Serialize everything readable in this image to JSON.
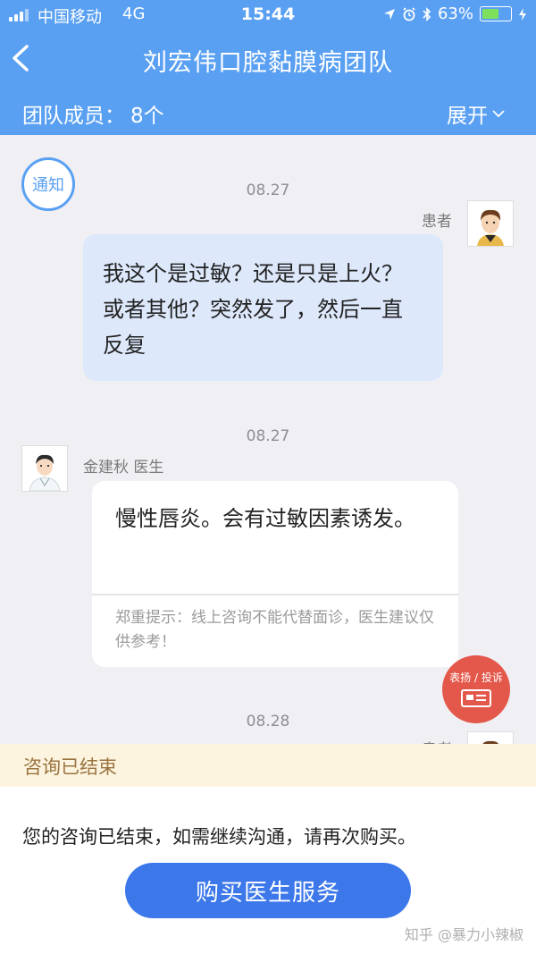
{
  "status_bar": {
    "carrier": "中国移动",
    "network": "4G",
    "time": "15:44",
    "battery": "63%",
    "battery_level": 0.63
  },
  "header": {
    "title": "刘宏伟口腔黏膜病团队",
    "team_label": "团队成员：",
    "team_count": "8个",
    "expand_label": "展开"
  },
  "notice_badge": "通知",
  "messages": [
    {
      "date": "08.27",
      "sender": "患者",
      "text": "我这个是过敏？还是只是上火？或者其他？突然发了，然后一直反复"
    },
    {
      "date": "08.27",
      "sender": "金建秋 医生",
      "text": "慢性唇炎。会有过敏因素诱发。",
      "tip": "郑重提示：线上咨询不能代替面诊，医生建议仅供参考！"
    },
    {
      "date": "08.28",
      "sender": "患者"
    }
  ],
  "complaint_button": "表扬 / 投诉",
  "consult_status": "咨询已结束",
  "footer": {
    "message": "您的咨询已结束，如需继续沟通，请再次购买。",
    "buy_button": "购买医生服务"
  },
  "watermark": "知乎 @暴力小辣椒",
  "colors": {
    "header_bg": "#5aa0f2",
    "patient_bubble": "#dde8fb",
    "buy_button": "#3d78eb",
    "complaint_button": "#e4584b",
    "ended_bar_bg": "#fdf4e0"
  }
}
